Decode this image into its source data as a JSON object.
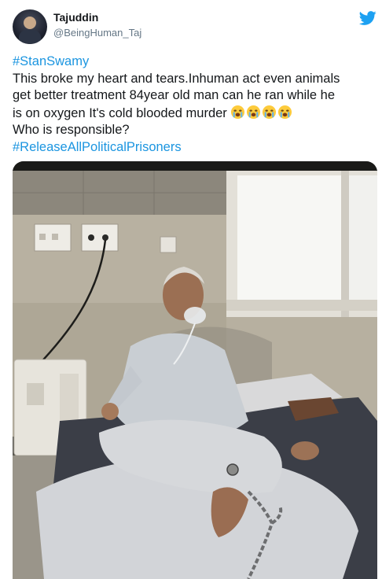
{
  "user": {
    "display_name": "Tajuddin",
    "handle": "@BeingHuman_Taj",
    "avatar_icon": "profile-avatar"
  },
  "tweet": {
    "hashtag_top": "#StanSwamy",
    "line1": "This broke my heart and tears.Inhuman act even animals",
    "line2": "get better treatment 84year old man can he ran while he",
    "line3": "is on oxygen It's cold blooded murder",
    "line4": "Who is responsible?",
    "hashtag_bottom": "#ReleaseAllPoliticalPrisoners",
    "emoji_icon": "loudly-crying-face",
    "emoji_count": 4
  },
  "icons": {
    "brand": "twitter-bird-icon"
  },
  "colors": {
    "hashtag": "#1b95e0",
    "text": "#14171a",
    "secondary": "#657786",
    "twitter_blue": "#1da1f2"
  },
  "media": {
    "type": "photo",
    "subject": "elderly man seated on hospital bed"
  }
}
